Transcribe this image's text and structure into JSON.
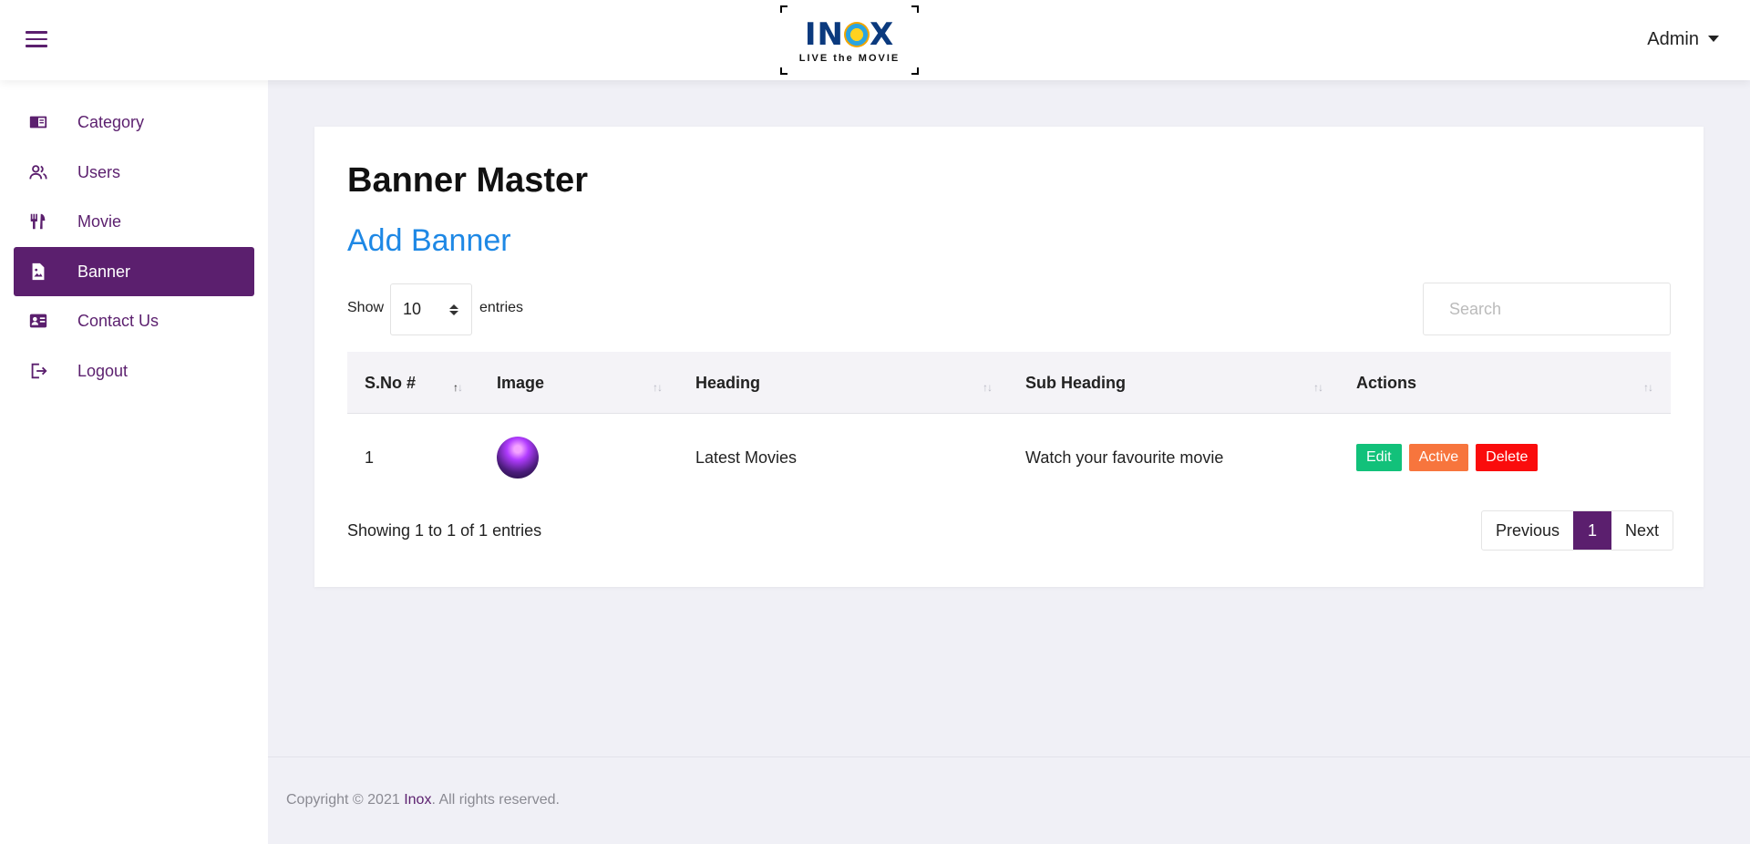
{
  "header": {
    "logo_text": "INOX",
    "logo_tagline": "LIVE the MOVIE",
    "user_label": "Admin"
  },
  "sidebar": {
    "items": [
      {
        "label": "Category",
        "icon": "category-book-icon"
      },
      {
        "label": "Users",
        "icon": "users-icon"
      },
      {
        "label": "Movie",
        "icon": "cutlery-icon"
      },
      {
        "label": "Banner",
        "icon": "image-file-icon",
        "active": true
      },
      {
        "label": "Contact Us",
        "icon": "contact-card-icon"
      },
      {
        "label": "Logout",
        "icon": "logout-icon"
      }
    ]
  },
  "main": {
    "title": "Banner Master",
    "add_label": "Add Banner",
    "show_label": "Show",
    "page_length": "10",
    "entries_label": "entries",
    "search_placeholder": "Search",
    "table": {
      "columns": [
        "S.No #",
        "Image",
        "Heading",
        "Sub Heading",
        "Actions"
      ],
      "rows": [
        {
          "sno": "1",
          "heading": "Latest Movies",
          "sub_heading": "Watch your favourite movie"
        }
      ],
      "actions": {
        "edit": "Edit",
        "active": "Active",
        "delete": "Delete"
      }
    },
    "info": "Showing 1 to 1 of 1 entries",
    "pagination": {
      "previous": "Previous",
      "current": "1",
      "next": "Next"
    }
  },
  "footer": {
    "prefix": "Copyright © 2021 ",
    "brand": "Inox",
    "suffix": ". All rights reserved."
  },
  "colors": {
    "brand_purple": "#5b1f6e",
    "link_blue": "#1e88e5",
    "edit_green": "#12c17a",
    "active_orange": "#f7753d",
    "delete_red": "#fa0c0c"
  }
}
